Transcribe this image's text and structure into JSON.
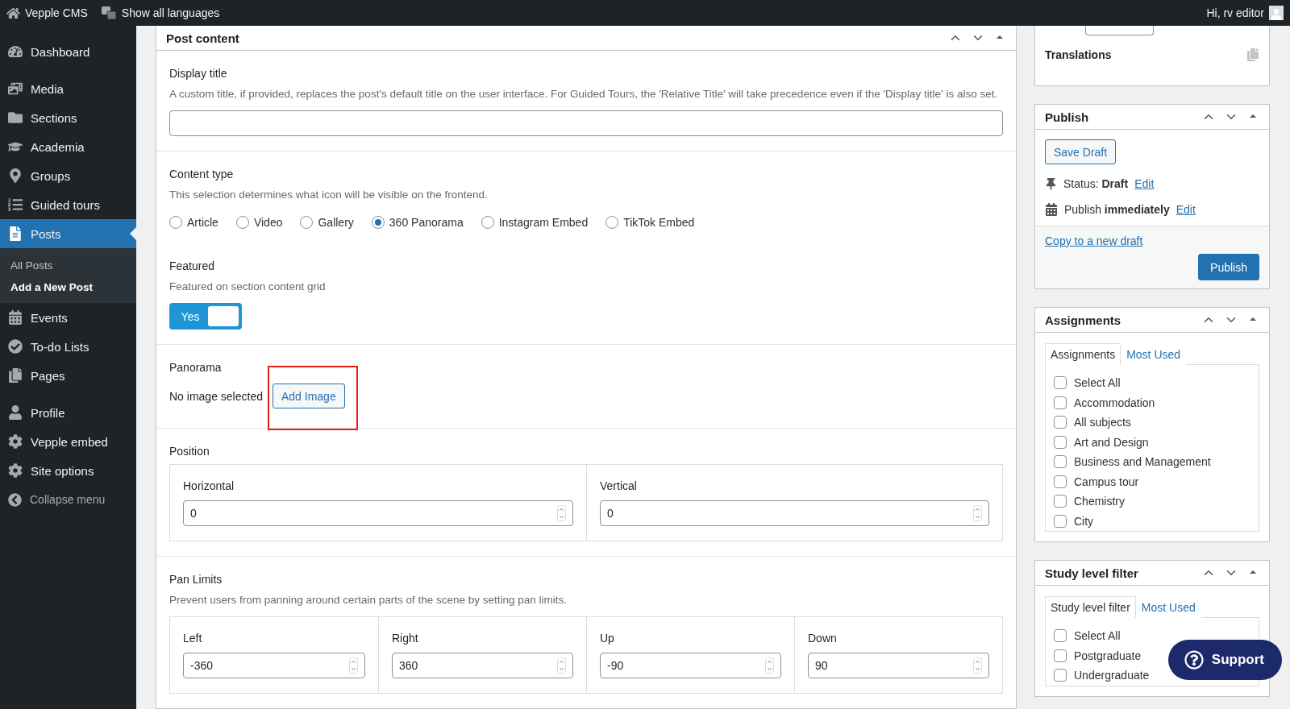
{
  "admin_bar": {
    "site": "Vepple CMS",
    "languages": "Show all languages",
    "greeting": "Hi, rv editor"
  },
  "menu": [
    {
      "label": "Dashboard",
      "selected": false
    },
    {
      "label": "Media",
      "selected": false
    },
    {
      "label": "Sections",
      "selected": false
    },
    {
      "label": "Academia",
      "selected": false
    },
    {
      "label": "Groups",
      "selected": false
    },
    {
      "label": "Guided tours",
      "selected": false
    },
    {
      "label": "Posts",
      "selected": true,
      "submenu": [
        {
          "label": "All Posts",
          "selected": false
        },
        {
          "label": "Add a New Post",
          "selected": true
        }
      ]
    },
    {
      "label": "Events",
      "selected": false
    },
    {
      "label": "To-do Lists",
      "selected": false
    },
    {
      "label": "Pages",
      "selected": false
    },
    {
      "label": "Profile",
      "selected": false
    },
    {
      "label": "Vepple embed",
      "selected": false
    },
    {
      "label": "Site options",
      "selected": false
    }
  ],
  "collapse_menu": "Collapse menu",
  "post_content": {
    "title": "Post content",
    "display_title": {
      "label": "Display title",
      "description": "A custom title, if provided, replaces the post's default title on the user interface. For Guided Tours, the 'Relative Title' will take precedence even if the 'Display title' is also set."
    },
    "content_type": {
      "label": "Content type",
      "description": "This selection determines what icon will be visible on the frontend.",
      "options": [
        {
          "label": "Article",
          "selected": false
        },
        {
          "label": "Video",
          "selected": false
        },
        {
          "label": "Gallery",
          "selected": false
        },
        {
          "label": "360 Panorama",
          "selected": true
        },
        {
          "label": "Instagram Embed",
          "selected": false
        },
        {
          "label": "TikTok Embed",
          "selected": false
        }
      ]
    },
    "featured": {
      "label": "Featured",
      "description": "Featured on section content grid",
      "toggle_label": "Yes",
      "on": true
    },
    "panorama": {
      "label": "Panorama",
      "status": "No image selected",
      "button": "Add Image",
      "highlighted": true
    },
    "position": {
      "label": "Position",
      "fields": [
        {
          "label": "Horizontal",
          "value": "0"
        },
        {
          "label": "Vertical",
          "value": "0"
        }
      ]
    },
    "pan_limits": {
      "label": "Pan Limits",
      "description": "Prevent users from panning around certain parts of the scene by setting pan limits.",
      "fields": [
        {
          "label": "Left",
          "value": "-360"
        },
        {
          "label": "Right",
          "value": "360"
        },
        {
          "label": "Up",
          "value": "-90"
        },
        {
          "label": "Down",
          "value": "90"
        }
      ]
    }
  },
  "translations": {
    "label": "Translations"
  },
  "publish": {
    "title": "Publish",
    "save_draft": "Save Draft",
    "status_label": "Status:",
    "status": "Draft",
    "status_edit": "Edit",
    "publish_label": "Publish",
    "publish_when": "immediately",
    "publish_edit": "Edit",
    "copy_link": "Copy to a new draft",
    "publish_button": "Publish"
  },
  "assignments": {
    "title": "Assignments",
    "tabs": [
      {
        "label": "Assignments",
        "selected": true
      },
      {
        "label": "Most Used",
        "selected": false
      }
    ],
    "items": [
      {
        "label": "Select All",
        "checked": false
      },
      {
        "label": "Accommodation",
        "checked": false
      },
      {
        "label": "All subjects",
        "checked": false
      },
      {
        "label": "Art and Design",
        "checked": false
      },
      {
        "label": "Business and Management",
        "checked": false
      },
      {
        "label": "Campus tour",
        "checked": false
      },
      {
        "label": "Chemistry",
        "checked": false
      },
      {
        "label": "City",
        "checked": false
      }
    ]
  },
  "study_level": {
    "title": "Study level filter",
    "tabs": [
      {
        "label": "Study level filter",
        "selected": true
      },
      {
        "label": "Most Used",
        "selected": false
      }
    ],
    "items": [
      {
        "label": "Select All",
        "checked": false
      },
      {
        "label": "Postgraduate",
        "checked": false
      },
      {
        "label": "Undergraduate",
        "checked": false
      }
    ]
  },
  "support_button": "Support"
}
